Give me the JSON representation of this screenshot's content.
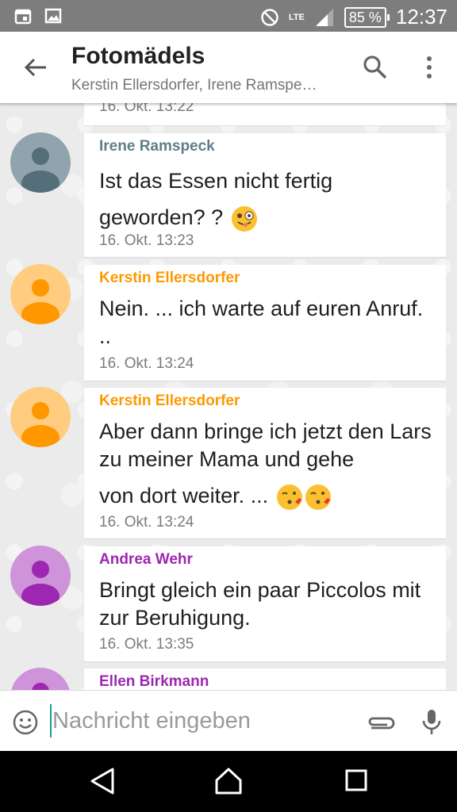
{
  "statusbar": {
    "time": "12:37",
    "battery": "85 %",
    "network": "LTE",
    "icons": [
      "calendar-icon",
      "image-icon",
      "do-not-disturb-icon",
      "signal-icon",
      "battery-icon"
    ]
  },
  "header": {
    "title": "Fotomädels",
    "subtitle": "Kerstin Ellersdorfer, Irene Ramspe…"
  },
  "colors": {
    "irene": "#607d8b",
    "kerstin": "#ff9800",
    "andrea": "#9c27b0",
    "ellen": "#9c27b0",
    "avatar_irene_bg": "#90a4ae",
    "avatar_kerstin_bg": "#ffcc80",
    "avatar_andrea_bg": "#ce93d8",
    "cursor": "#1a9e8f"
  },
  "messages": [
    {
      "time": "16. Okt. 13:22"
    },
    {
      "sender": "Irene Ramspeck",
      "text_line1": "Ist das Essen nicht fertig",
      "text_line2": "geworden? ?",
      "time": "16. Okt. 13:23",
      "emoji": "winking-face-with-tongue"
    },
    {
      "sender": "Kerstin Ellersdorfer",
      "text": "Nein. ... ich warte auf euren Anruf. ..",
      "time": "16. Okt. 13:24"
    },
    {
      "sender": "Kerstin Ellersdorfer",
      "text_line1": "Aber dann bringe ich jetzt den Lars zu meiner Mama und gehe",
      "text_line2": "von dort weiter. ...",
      "time": "16. Okt. 13:24",
      "emoji": "face-blowing-kiss"
    },
    {
      "sender": "Andrea Wehr",
      "text": "Bringt gleich ein paar Piccolos mit zur Beruhigung.",
      "time": "16. Okt. 13:35"
    },
    {
      "sender": "Ellen Birkmann"
    }
  ],
  "input": {
    "placeholder": "Nachricht eingeben"
  }
}
